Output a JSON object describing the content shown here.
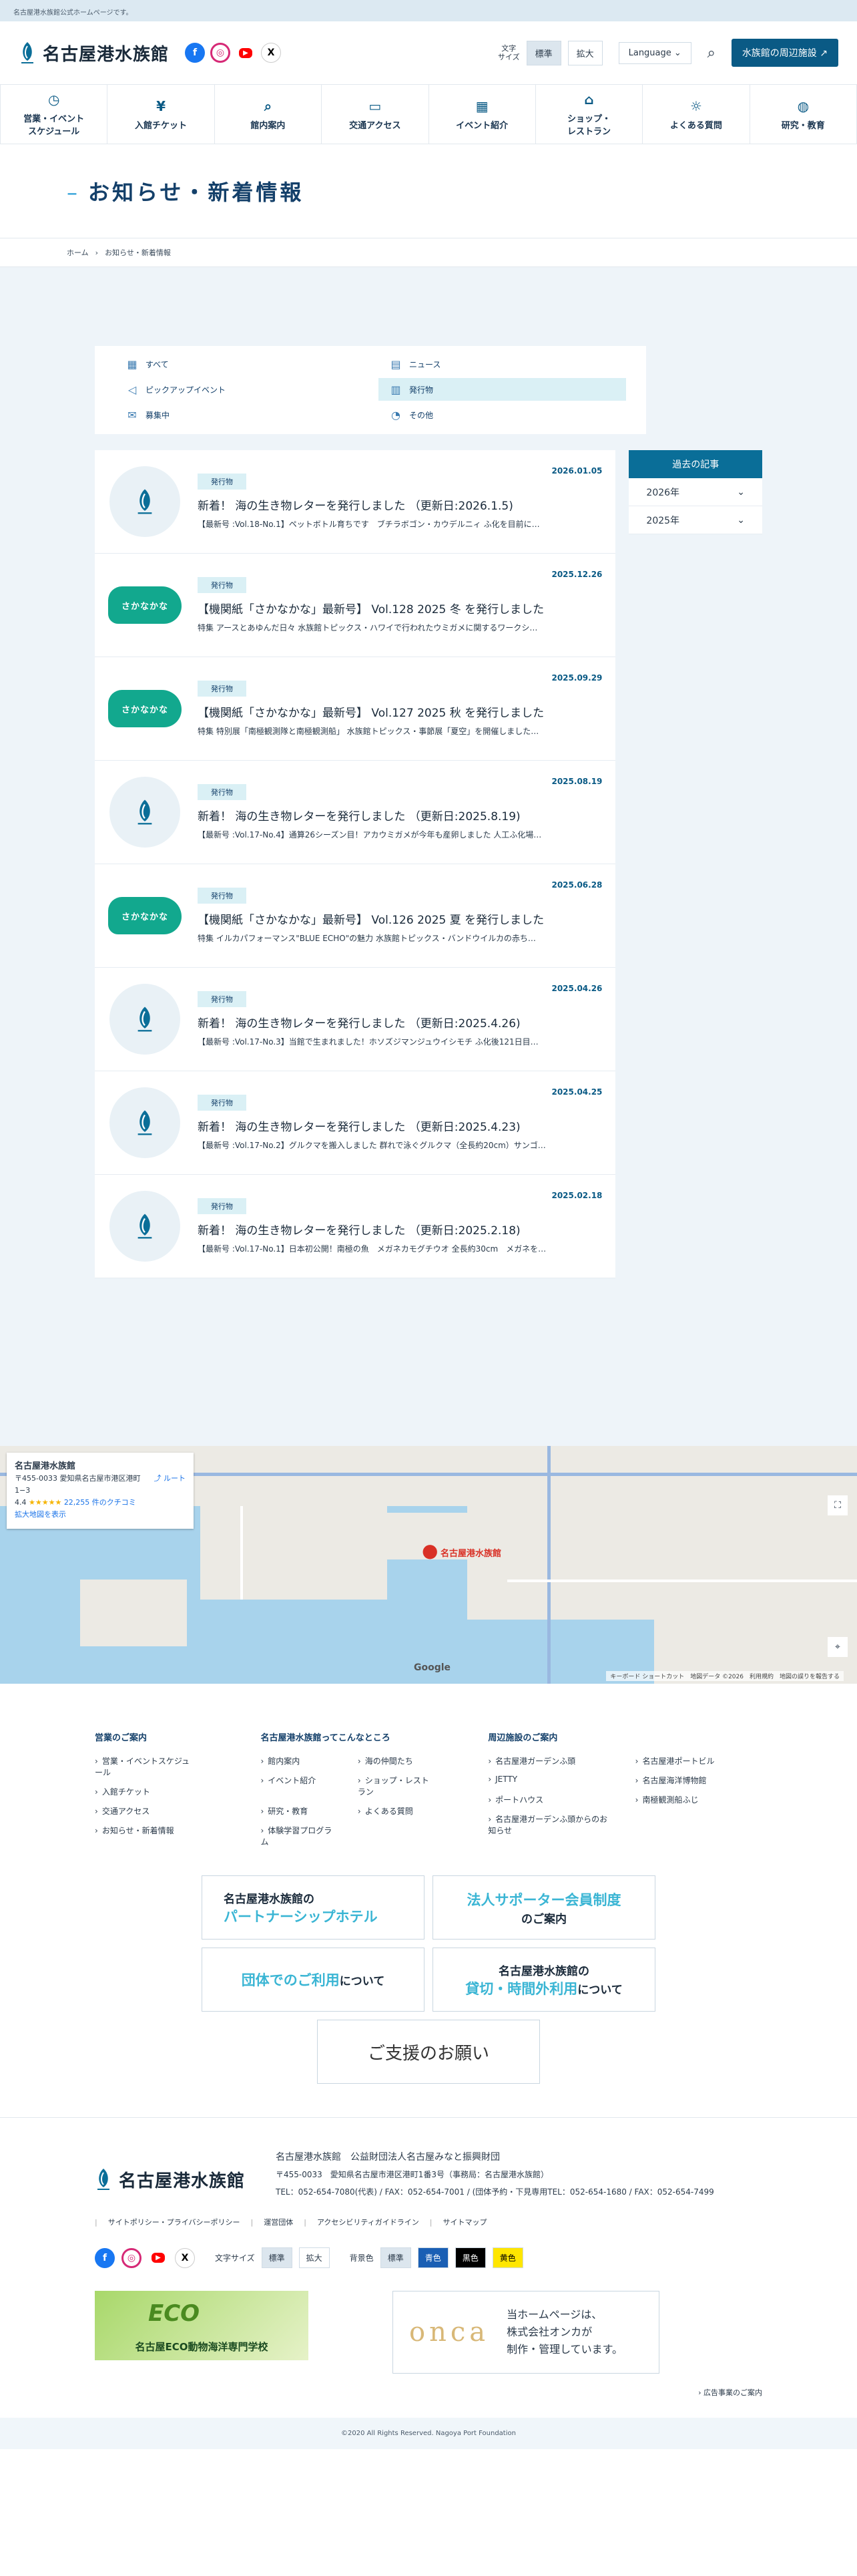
{
  "topbar": {
    "text": "名古屋港水族館公式ホームページです。"
  },
  "header": {
    "logo_text": "名古屋港水族館",
    "font_size_label": "文字\nサイズ",
    "font_size_options": [
      "標準",
      "拡大"
    ],
    "language": "Language",
    "nearby_button": "水族館の周辺施設"
  },
  "nav": [
    {
      "icon": "clock-icon",
      "glyph": "◷",
      "label": "営業・イベント\nスケジュール"
    },
    {
      "icon": "yen-icon",
      "glyph": "¥",
      "label": "入館チケット"
    },
    {
      "icon": "map-search-icon",
      "glyph": "⌕",
      "label": "館内案内"
    },
    {
      "icon": "bus-icon",
      "glyph": "▭",
      "label": "交通アクセス"
    },
    {
      "icon": "calendar-icon",
      "glyph": "▦",
      "label": "イベント紹介"
    },
    {
      "icon": "shop-icon",
      "glyph": "⌂",
      "label": "ショップ・\nレストラン"
    },
    {
      "icon": "lightbulb-icon",
      "glyph": "☼",
      "label": "よくある質問"
    },
    {
      "icon": "globe-icon",
      "glyph": "◍",
      "label": "研究・教育"
    }
  ],
  "page": {
    "title": "お知らせ・新着情報"
  },
  "breadcrumb": {
    "home": "ホーム",
    "current": "お知らせ・新着情報"
  },
  "categories": [
    {
      "icon": "grid-icon",
      "glyph": "▦",
      "label": "すべて",
      "active": false
    },
    {
      "icon": "news-icon",
      "glyph": "▤",
      "label": "ニュース",
      "active": false
    },
    {
      "icon": "megaphone-icon",
      "glyph": "◁",
      "label": "ピックアップイベント",
      "active": false
    },
    {
      "icon": "book-icon",
      "glyph": "▥",
      "label": "発行物",
      "active": true
    },
    {
      "icon": "mail-icon",
      "glyph": "✉",
      "label": "募集中",
      "active": false
    },
    {
      "icon": "other-icon",
      "glyph": "◔",
      "label": "その他",
      "active": false
    }
  ],
  "articles": [
    {
      "thumb": "logo",
      "category": "発行物",
      "date": "2026.01.05",
      "title": "新着！ 海の生き物レターを発行しました （更新日:2026.1.5)",
      "desc": "【最新号 :Vol.18-No.1】ペットボトル育ちです　ブチラボゴン・カウデルニィ ふ化を目前に…"
    },
    {
      "thumb": "sakana",
      "category": "発行物",
      "date": "2025.12.26",
      "title": "【機関紙「さかなかな」最新号】 Vol.128 2025 冬 を発行しました",
      "desc": "特集 アースとあゆんだ日々 水族館トピックス・ハワイで行われたウミガメに関するワークシ…"
    },
    {
      "thumb": "sakana",
      "category": "発行物",
      "date": "2025.09.29",
      "title": "【機関紙「さかなかな」最新号】 Vol.127 2025 秋 を発行しました",
      "desc": "特集 特別展「南極観測隊と南極観測船」 水族館トピックス・事節展「夏空」を開催しました…"
    },
    {
      "thumb": "logo",
      "category": "発行物",
      "date": "2025.08.19",
      "title": "新着！ 海の生き物レターを発行しました （更新日:2025.8.19)",
      "desc": "【最新号 :Vol.17-No.4】通算26シーズン目！アカウミガメが今年も産卵しました 人工ふ化場…"
    },
    {
      "thumb": "sakana",
      "category": "発行物",
      "date": "2025.06.28",
      "title": "【機関紙「さかなかな」最新号】 Vol.126 2025 夏 を発行しました",
      "desc": "特集 イルカパフォーマンス\"BLUE ECHO\"の魅力 水族館トピックス・バンドウイルカの赤ち…"
    },
    {
      "thumb": "logo",
      "category": "発行物",
      "date": "2025.04.26",
      "title": "新着！ 海の生き物レターを発行しました （更新日:2025.4.26)",
      "desc": "【最新号 :Vol.17-No.3】当館で生まれました！ホソズジマンジュウイシモチ ふ化後121日目…"
    },
    {
      "thumb": "logo",
      "category": "発行物",
      "date": "2025.04.25",
      "title": "新着！ 海の生き物レターを発行しました （更新日:2025.4.23)",
      "desc": "【最新号 :Vol.17-No.2】グルクマを搬入しました 群れで泳ぐグルクマ（全長約20cm）サンゴ…"
    },
    {
      "thumb": "logo",
      "category": "発行物",
      "date": "2025.02.18",
      "title": "新着！ 海の生き物レターを発行しました （更新日:2025.2.18)",
      "desc": "【最新号 :Vol.17-No.1】日本初公開！南極の魚　メガネカモグチウオ 全長約30cm　メガネを…"
    }
  ],
  "sidebar": {
    "title": "過去の記事",
    "years": [
      "2026年",
      "2025年"
    ]
  },
  "map": {
    "place_name": "名古屋港水族館",
    "address": "〒455-0033 愛知県名古屋市港区港町1−3",
    "route": "ルート",
    "rating": "4.4",
    "stars": "★★★★★",
    "reviews": "22,255 件のクチコミ",
    "larger_map": "拡大地図を表示",
    "pin_label": "名古屋港水族館",
    "google": "Google",
    "footer": "キーボード ショートカット　地図データ ©2026　利用規約　地図の誤りを報告する"
  },
  "footer_links": {
    "col1": {
      "title": "営業のご案内",
      "items": [
        "営業・イベントスケジュール",
        "入館チケット",
        "交通アクセス",
        "お知らせ・新着情報"
      ]
    },
    "col2": {
      "title": "名古屋港水族館ってこんなところ",
      "items": [
        "館内案内",
        "海の仲間たち",
        "イベント紹介",
        "ショップ・レストラン",
        "研究・教育",
        "よくある質問",
        "体験学習プログラム"
      ]
    },
    "col3": {
      "title": "周辺施設のご案内",
      "items": [
        "名古屋港ガーデンふ頭",
        "名古屋港ポートビル",
        "JETTY",
        "名古屋海洋博物館",
        "ポートハウス",
        "南極観測船ふじ",
        "名古屋港ガーデンふ頭からのお知らせ"
      ]
    }
  },
  "banners": {
    "b1_top": "名古屋港水族館の",
    "b1_hl": "パートナーシップホテル",
    "b2_hl": "法人サポーター会員制度",
    "b2_bottom": "のご案内",
    "b3_hl": "団体でのご利用",
    "b3_rest": "について",
    "b4_top": "名古屋港水族館の",
    "b4_hl": "貸切・時間外利用",
    "b4_rest": "について",
    "help": "ご支援のお願い"
  },
  "foot_info": {
    "logo_text": "名古屋港水族館",
    "org": "名古屋港水族館　公益財団法人名古屋みなと振興財団",
    "address": "〒455-0033　愛知県名古屋市港区港町1番3号（事務局：名古屋港水族館）",
    "tel": "TEL：052-654-7080(代表) / FAX：052-654-7001 / (団体予約・下見専用TEL：052-654-1680 / FAX：052-654-7499",
    "links": [
      "サイトポリシー・プライバシーポリシー",
      "運営団体",
      "アクセシビリティガイドライン",
      "サイトマップ"
    ],
    "font_size": "文字サイズ",
    "font_opts": [
      "標準",
      "拡大"
    ],
    "bg_label": "背景色",
    "bg_opts": [
      "標準",
      "青色",
      "黒色",
      "黄色"
    ],
    "eco_word": "ECO",
    "eco_text": "名古屋ECO動物海洋専門学校",
    "onca_logo": "onca",
    "onca_text": "当ホームページは、\n株式会社オンカが\n制作・管理しています。",
    "ad_link": "広告事業のご案内",
    "copyright": "©2020 All Rights Reserved. Nagoya Port Foundation"
  }
}
